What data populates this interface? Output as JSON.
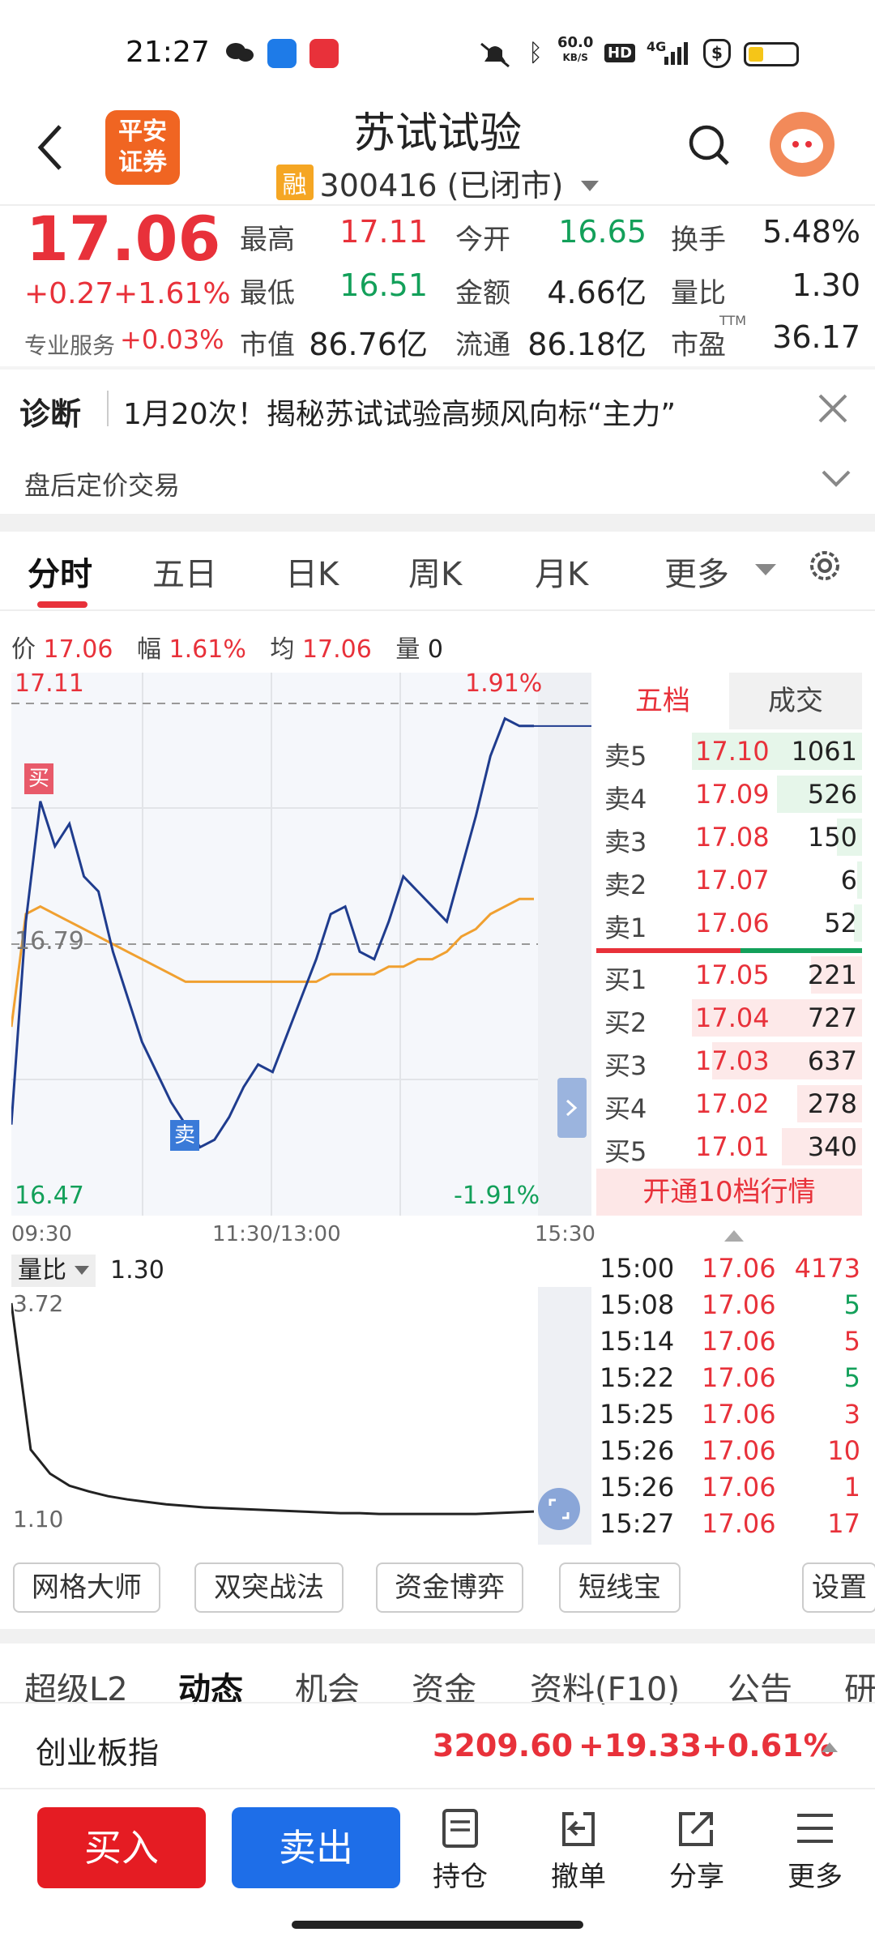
{
  "status_bar": {
    "time": "21:27",
    "net_speed": "60.0",
    "net_unit": "KB/S",
    "hd": "HD",
    "signal": "4G"
  },
  "header": {
    "back_icon": "chevron-left-icon",
    "broker_logo": "平安\n证券",
    "broker_logo_line1": "平安",
    "broker_logo_line2": "证券",
    "title": "苏试试验",
    "margin_tag": "融",
    "code_status": "300416 (已闭市)",
    "search_icon": "search-icon"
  },
  "quote": {
    "price": "17.06",
    "change": "+0.27",
    "change_pct": "+1.61%",
    "pro_label": "专业服务",
    "pro_value": "+0.03%",
    "fields": [
      {
        "label": "最高",
        "value": "17.11",
        "color": "red"
      },
      {
        "label": "今开",
        "value": "16.65",
        "color": "green"
      },
      {
        "label": "换手",
        "value": "5.48%",
        "color": "dark"
      },
      {
        "label": "最低",
        "value": "16.51",
        "color": "green"
      },
      {
        "label": "金额",
        "value": "4.66亿",
        "color": "dark"
      },
      {
        "label": "量比",
        "value": "1.30",
        "color": "dark"
      },
      {
        "label": "市值",
        "value": "86.76亿",
        "color": "dark"
      },
      {
        "label": "流通",
        "value": "86.18亿",
        "color": "dark"
      },
      {
        "label": "市盈",
        "value": "36.17",
        "color": "dark"
      }
    ],
    "ttm": "TTM"
  },
  "diag": {
    "label": "诊断",
    "text": "1月20次！揭秘苏试试验高频风向标“主力”",
    "after_hours": "盘后定价交易"
  },
  "tabs": [
    "分时",
    "五日",
    "日K",
    "周K",
    "月K",
    "更多"
  ],
  "chart_info": {
    "price_label": "价",
    "price": "17.06",
    "amp_label": "幅",
    "amp": "1.61%",
    "avg_label": "均",
    "avg": "17.06",
    "vol_label": "量",
    "vol": "0"
  },
  "chart_data": {
    "type": "line",
    "price_max": "17.11",
    "price_mid": "16.79",
    "price_min": "16.47",
    "pct_max": "1.91%",
    "pct_min": "-1.91%",
    "time_start": "09:30",
    "time_mid": "11:30/13:00",
    "time_end": "15:30",
    "ylim": [
      16.47,
      17.11
    ],
    "series": [
      {
        "values": [
          16.55,
          16.82,
          16.98,
          16.92,
          16.95,
          16.88,
          16.86,
          16.78,
          16.72,
          16.66,
          16.62,
          16.58,
          16.55,
          16.52,
          16.53,
          16.56,
          16.6,
          16.63,
          16.62,
          16.67,
          16.72,
          16.77,
          16.83,
          16.84,
          16.78,
          16.77,
          16.82,
          16.88,
          16.86,
          16.84,
          16.82,
          16.89,
          16.96,
          17.04,
          17.09,
          17.08,
          17.08
        ]
      },
      {
        "values": [
          16.68,
          16.83,
          16.84,
          16.83,
          16.82,
          16.81,
          16.8,
          16.79,
          16.78,
          16.77,
          16.76,
          16.75,
          16.74,
          16.74,
          16.74,
          16.74,
          16.74,
          16.74,
          16.74,
          16.74,
          16.74,
          16.74,
          16.75,
          16.75,
          16.75,
          16.75,
          16.76,
          16.76,
          16.77,
          16.77,
          16.78,
          16.8,
          16.81,
          16.83,
          16.84,
          16.85,
          16.85
        ]
      }
    ],
    "buy_marker": "买",
    "sell_marker": "卖",
    "volume_ratio_label": "量比",
    "volume_ratio_value": "1.30",
    "vr_max": "3.72",
    "vr_min": "1.10",
    "vr_values": [
      3.72,
      1.9,
      1.6,
      1.45,
      1.38,
      1.32,
      1.28,
      1.25,
      1.22,
      1.2,
      1.18,
      1.17,
      1.16,
      1.15,
      1.14,
      1.13,
      1.12,
      1.11,
      1.11,
      1.1,
      1.1,
      1.1,
      1.1,
      1.1,
      1.1,
      1.11,
      1.12,
      1.13
    ]
  },
  "orderbook": {
    "tab_five": "五档",
    "tab_trades": "成交",
    "asks": [
      {
        "label": "卖5",
        "price": "17.10",
        "vol": "1061",
        "depth": 1.0
      },
      {
        "label": "卖4",
        "price": "17.09",
        "vol": "526",
        "depth": 0.5
      },
      {
        "label": "卖3",
        "price": "17.08",
        "vol": "150",
        "depth": 0.15
      },
      {
        "label": "卖2",
        "price": "17.07",
        "vol": "6",
        "depth": 0.02
      },
      {
        "label": "卖1",
        "price": "17.06",
        "vol": "52",
        "depth": 0.05
      }
    ],
    "bids": [
      {
        "label": "买1",
        "price": "17.05",
        "vol": "221",
        "depth": 0.3
      },
      {
        "label": "买2",
        "price": "17.04",
        "vol": "727",
        "depth": 1.0
      },
      {
        "label": "买3",
        "price": "17.03",
        "vol": "637",
        "depth": 0.88
      },
      {
        "label": "买4",
        "price": "17.02",
        "vol": "278",
        "depth": 0.38
      },
      {
        "label": "买5",
        "price": "17.01",
        "vol": "340",
        "depth": 0.47
      }
    ],
    "open_l2": "开通10档行情",
    "trades": [
      {
        "time": "15:00",
        "price": "17.06",
        "vol": "4173",
        "color": "red"
      },
      {
        "time": "15:08",
        "price": "17.06",
        "vol": "5",
        "color": "green"
      },
      {
        "time": "15:14",
        "price": "17.06",
        "vol": "5",
        "color": "red"
      },
      {
        "time": "15:22",
        "price": "17.06",
        "vol": "5",
        "color": "green"
      },
      {
        "time": "15:25",
        "price": "17.06",
        "vol": "3",
        "color": "red"
      },
      {
        "time": "15:26",
        "price": "17.06",
        "vol": "10",
        "color": "red"
      },
      {
        "time": "15:26",
        "price": "17.06",
        "vol": "1",
        "color": "red"
      },
      {
        "time": "15:27",
        "price": "17.06",
        "vol": "17",
        "color": "red"
      }
    ]
  },
  "tools": [
    "网格大师",
    "双突战法",
    "资金博弈",
    "短线宝",
    "设置"
  ],
  "subtabs": [
    "超级L2",
    "动态",
    "机会",
    "资金",
    "资料(F10)",
    "公告",
    "研"
  ],
  "index_bar": {
    "name": "创业板指",
    "value": "3209.60",
    "change": "+19.33",
    "pct": "+0.61%"
  },
  "actions": {
    "buy": "买入",
    "sell": "卖出",
    "hold": "持仓",
    "cancel": "撤单",
    "share": "分享",
    "more": "更多"
  },
  "colors": {
    "red": "#e8313a",
    "green": "#13a05a",
    "blue": "#1e62e8",
    "orange": "#f5a623",
    "price_line": "#1f3c8e",
    "avg_line": "#f0a030"
  }
}
